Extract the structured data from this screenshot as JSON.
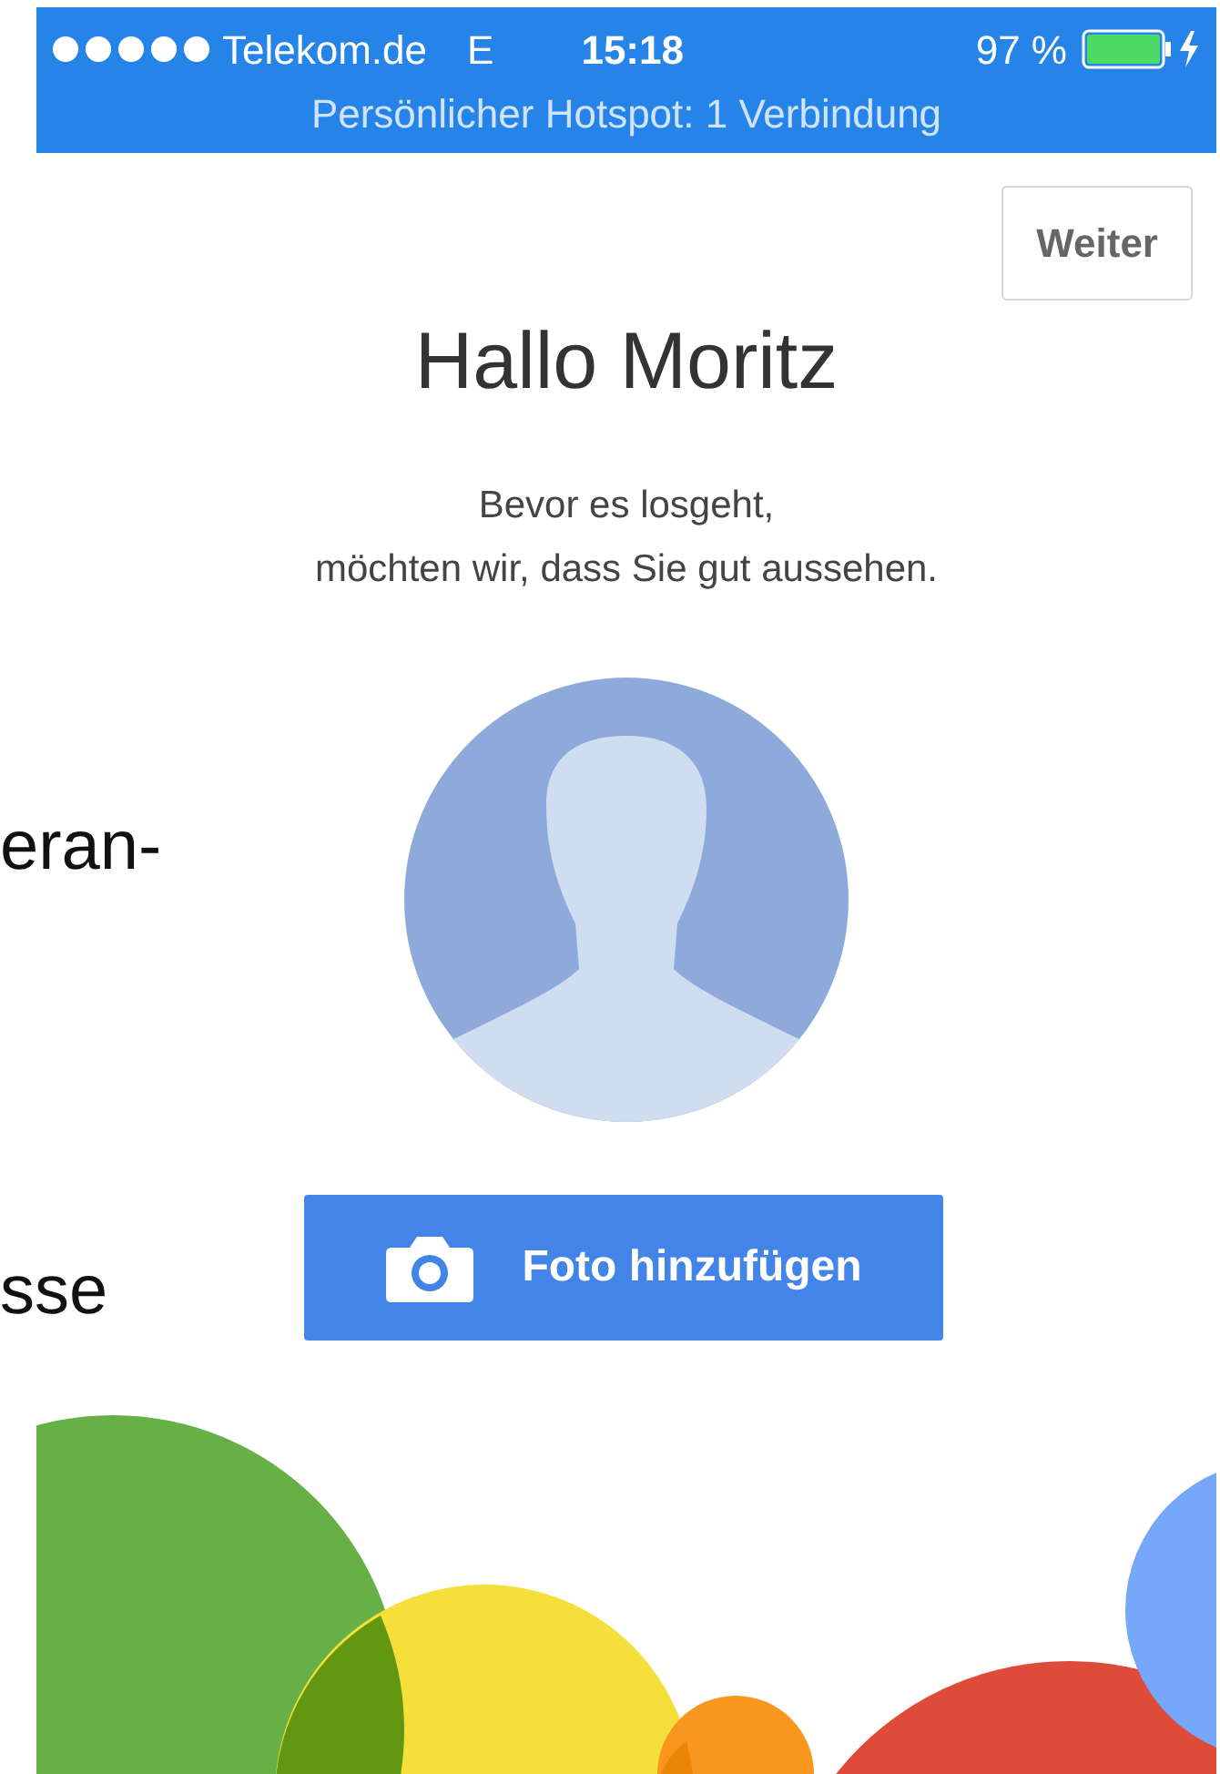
{
  "status_bar": {
    "carrier": "Telekom.de",
    "network": "E",
    "time": "15:18",
    "battery": "97 %",
    "hotspot": "Persönlicher Hotspot: 1 Verbindung"
  },
  "next_button": "Weiter",
  "greeting": "Hallo Moritz",
  "intro": [
    "Bevor es losgeht,",
    "möchten wir, dass Sie gut aussehen."
  ],
  "add_photo_button": "Foto hinzufügen",
  "background_text": [
    "eran-",
    "sse"
  ]
}
